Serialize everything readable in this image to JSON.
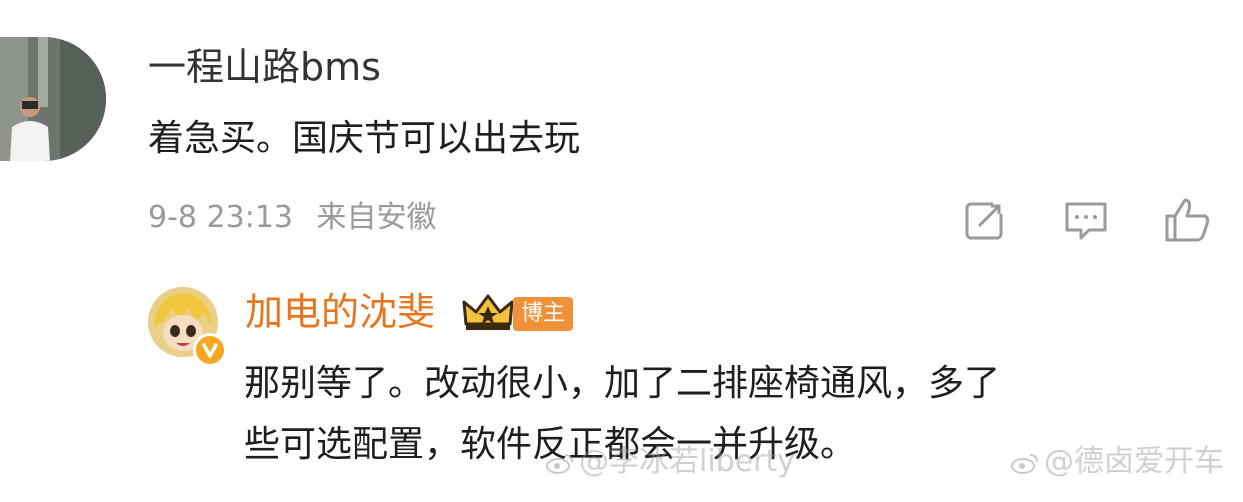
{
  "comment": {
    "username": "一程山路bms",
    "text": "着急买。国庆节可以出去玩",
    "time": "9-8 23:13",
    "location": "来自安徽"
  },
  "reply": {
    "username": "加电的沈斐",
    "badge": "博主",
    "text_line1": "那别等了。改动很小，加了二排座椅通风，多了",
    "text_line2": "些可选配置，软件反正都会一并升级。"
  },
  "watermarks": {
    "left": "@李冰若liberty",
    "right": "@德卤爱开车"
  },
  "colors": {
    "reply_username": "#e8741e",
    "badge_bg": "#f0913a",
    "meta_gray": "#9a9a9a"
  }
}
